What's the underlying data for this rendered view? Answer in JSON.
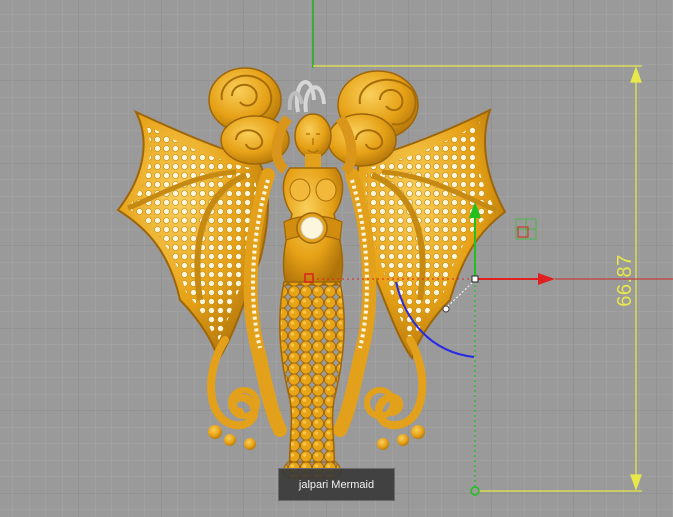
{
  "viewport": {
    "background_color": "#9a9a9a",
    "grid_minor_color": "#a4a4a4",
    "grid_major_color": "#8a8a8a"
  },
  "model": {
    "name": "jalpari Mermaid",
    "material_color": "#e8a417",
    "highlight_color": "#f7c648",
    "shadow_color": "#a86d08",
    "gem_color": "#fbf6dd",
    "bail_color": "#d9d9d9"
  },
  "dimension": {
    "value": "66.87",
    "color": "#e8e84a"
  },
  "gizmo": {
    "x_axis_color": "#e02020",
    "y_axis_color": "#20c020",
    "rotation_arc_color": "#2020e0"
  },
  "tooltip": {
    "label": "jalpari Mermaid"
  }
}
